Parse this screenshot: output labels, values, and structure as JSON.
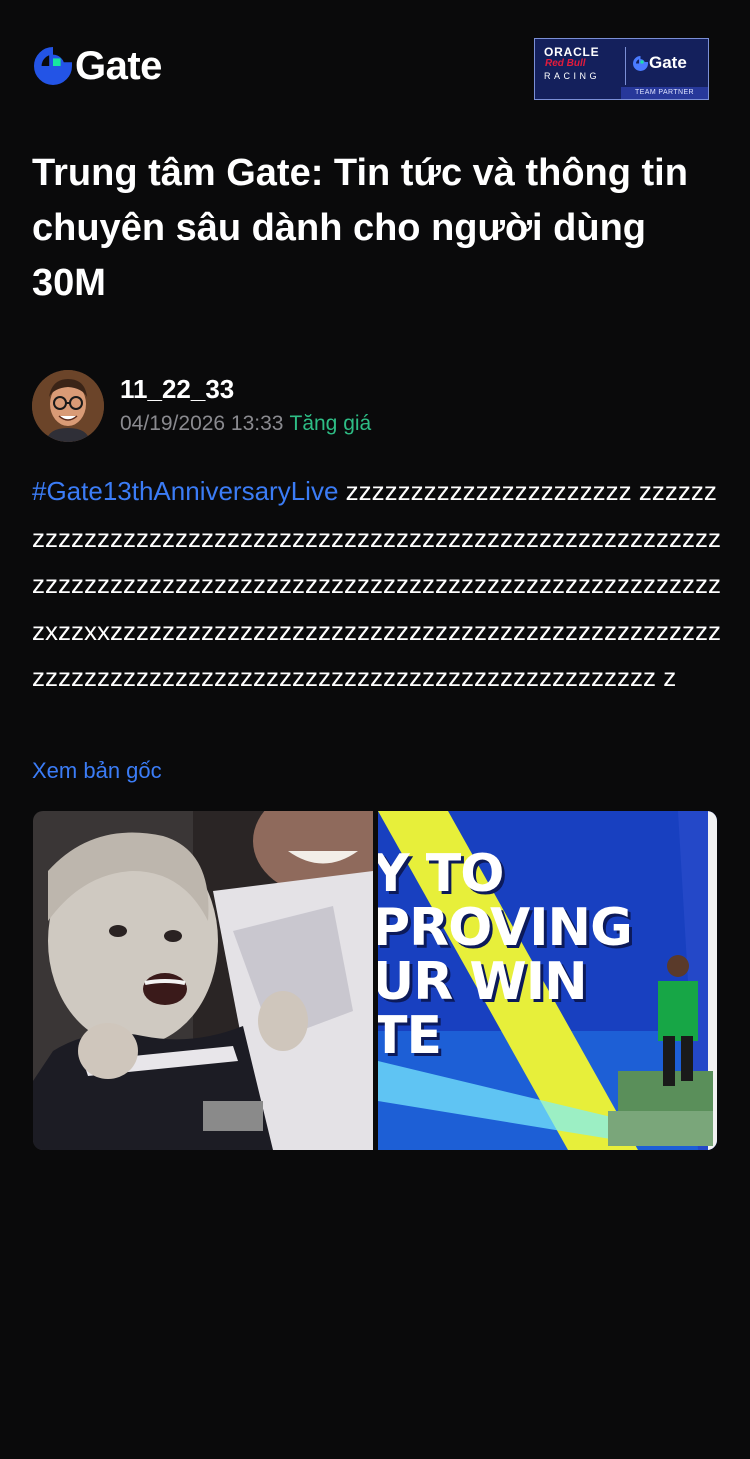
{
  "header": {
    "logo_text": "Gate",
    "partner": {
      "oracle": "ORACLE",
      "redbull": "Red Bull",
      "racing": "RACING",
      "gate": "Gate",
      "tag": "TEAM PARTNER"
    }
  },
  "title": "Trung tâm Gate: Tin tức và thông tin chuyên sâu dành cho người dùng 30M",
  "post": {
    "author": "11_22_33",
    "date": "04/19/2026 13:33",
    "trend": "Tăng giá",
    "hashtag": "#Gate13thAnniversaryLive",
    "text": " zzzzzzzzzzzzzzzzzzzzzz zzzzzzzzzzzzzzzzzzzzzzzzzzzzzzzzzzzzzzzzzzzzzzzzzzzzzzzzzzzzzzzzzzzzzzzzzzzzzzzzzzzzzzzzzzzzzzzzzzzzzzzzzzzzzzzzzxzzxxzzzzzzzzzzzzzzzzzzzzzzzzzzzzzzzzzzzzzzzzzzzzzzzzzzzzzzzzzzzzzzzzzzzzzzzzzzzzzzzzzzzzzzzzzzzzzzz z",
    "view_original": "Xem bản gốc"
  },
  "media": {
    "right_overlay": [
      "Y TO",
      "PROVING",
      "UR WIN",
      "TE"
    ]
  },
  "colors": {
    "background": "#0a0a0b",
    "link_blue": "#3b7cf6",
    "trend_green": "#2ebd85",
    "meta_gray": "#8a8a8f"
  }
}
